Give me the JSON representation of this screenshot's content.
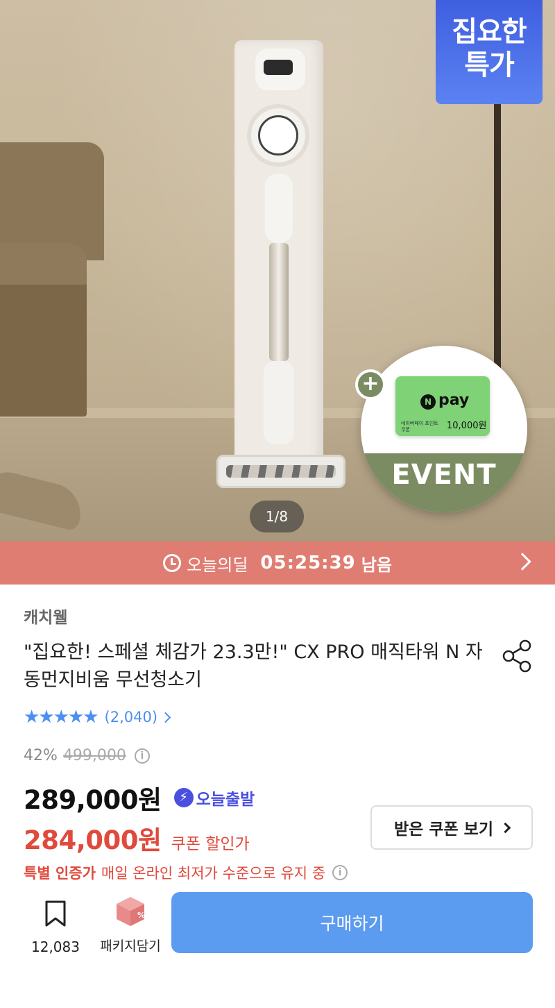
{
  "hero": {
    "badge_line1": "집요한",
    "badge_line2": "특가",
    "event_label": "EVENT",
    "npay_logo_letter": "N",
    "npay_brand": "pay",
    "npay_card_text": "네이버페이 포인트 쿠폰",
    "npay_amount": "10,000원",
    "plus": "+",
    "pager": "1/8",
    "colors": {
      "badge": "#3f5fe0",
      "event_band": "#7b8c63",
      "npay_card": "#7fd275"
    }
  },
  "deal": {
    "label": "오늘의딜",
    "time": "05:25:39",
    "remain": "남음",
    "icon": "clock-icon",
    "color": "#e07d72"
  },
  "product": {
    "brand": "캐치웰",
    "title": "\"집요한! 스페셜 체감가 23.3만!\" CX PRO 매직타워 N 자동먼지비움 무선청소기",
    "rating_stars": "★★★★★",
    "review_count": "(2,040)",
    "discount": "42%",
    "original_price": "499,000",
    "price": "289,000원",
    "today_ship": "오늘출발",
    "coupon_price": "284,000원",
    "coupon_label": "쿠폰 할인가",
    "coupon_button": "받은 쿠폰 보기",
    "certified_strong": "특별 인증가",
    "certified_text": "매일 온라인 최저가 수준으로 유지 중",
    "info_glyph": "i",
    "colors": {
      "accent_blue": "#4c8ff0",
      "sale_red": "#e04a3c",
      "ship_purple": "#4b4fe0"
    }
  },
  "bottom": {
    "bookmark_count": "12,083",
    "package_label": "패키지담기",
    "buy_label": "구매하기",
    "colors": {
      "buy": "#5b9bf0"
    }
  }
}
